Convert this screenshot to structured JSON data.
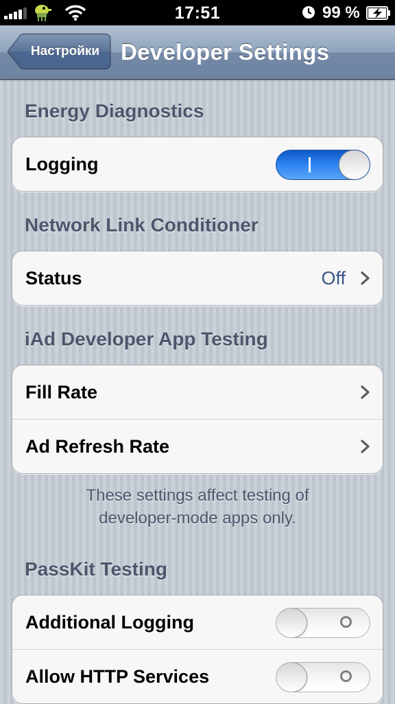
{
  "status_bar": {
    "time": "17:51",
    "battery_percent": "99 %",
    "signal_bars": 4,
    "icons": [
      "signal-icon",
      "doodle-jump-icon",
      "wifi-icon",
      "clock-icon",
      "battery-charging-icon"
    ]
  },
  "nav": {
    "back_label": "Настройки",
    "title": "Developer Settings"
  },
  "sections": {
    "energy": {
      "header": "Energy Diagnostics",
      "rows": [
        {
          "label": "Logging",
          "type": "switch",
          "on": true
        }
      ]
    },
    "network": {
      "header": "Network Link Conditioner",
      "rows": [
        {
          "label": "Status",
          "value": "Off",
          "type": "disclosure"
        }
      ]
    },
    "iad": {
      "header": "iAd Developer App Testing",
      "rows": [
        {
          "label": "Fill Rate",
          "type": "disclosure"
        },
        {
          "label": "Ad Refresh Rate",
          "type": "disclosure"
        }
      ],
      "footer_line1": "These settings affect testing of",
      "footer_line2": "developer-mode apps only."
    },
    "passkit": {
      "header": "PassKit Testing",
      "rows": [
        {
          "label": "Additional Logging",
          "type": "switch",
          "on": false
        },
        {
          "label": "Allow HTTP Services",
          "type": "switch",
          "on": false
        }
      ]
    }
  },
  "colors": {
    "background": "#c5ccd4",
    "section_header": "#4c566c",
    "value_text": "#385487",
    "switch_on": "#2e85f0",
    "navbar": "#8ea3bd"
  }
}
